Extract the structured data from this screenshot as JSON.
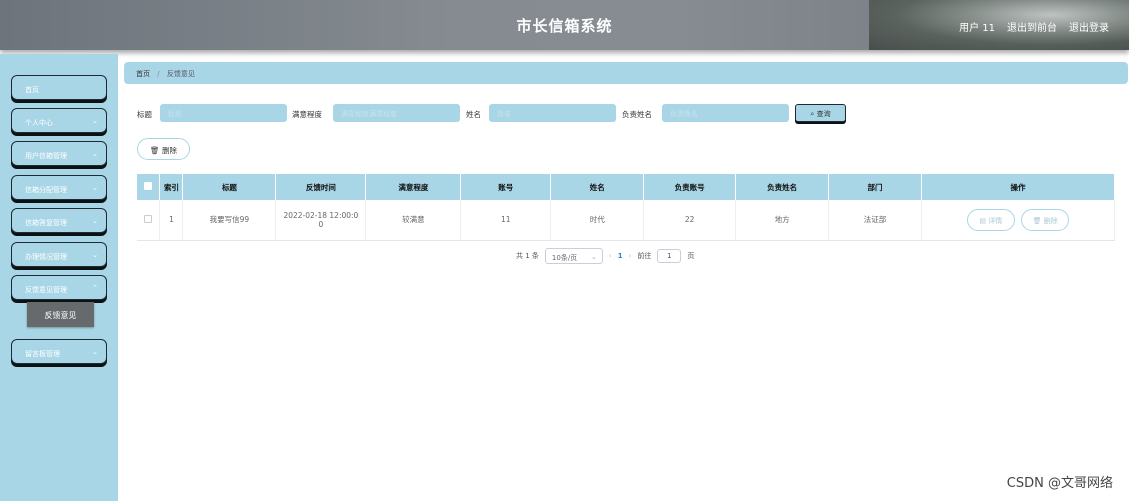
{
  "header": {
    "title": "市长信箱系统",
    "user": "用户 11",
    "back_front": "退出到前台",
    "logout": "退出登录"
  },
  "sidebar": {
    "items": [
      {
        "label": "首页"
      },
      {
        "label": "个人中心"
      },
      {
        "label": "用户信箱管理"
      },
      {
        "label": "信箱分配管理"
      },
      {
        "label": "信箱答复管理"
      },
      {
        "label": "办理情况管理"
      },
      {
        "label": "反馈意见管理"
      },
      {
        "label": "留言板管理"
      }
    ],
    "submenu": "反馈意见"
  },
  "breadcrumb": {
    "home": "首页",
    "sep": "/",
    "current": "反馈意见"
  },
  "search": {
    "title_label": "标题",
    "title_placeholder": "标题",
    "satisfaction_label": "满意程度",
    "satisfaction_placeholder": "满意程度满意程度",
    "name_label": "姓名",
    "name_placeholder": "姓名",
    "owner_label": "负责姓名",
    "owner_placeholder": "负责姓名",
    "query_button": "查询"
  },
  "actions": {
    "delete_button": "删除"
  },
  "table": {
    "headers": [
      "索引",
      "标题",
      "反馈时间",
      "满意程度",
      "账号",
      "姓名",
      "负责账号",
      "负责姓名",
      "部门",
      "操作"
    ],
    "rows": [
      {
        "index": "1",
        "title": "我要写信99",
        "time_line1": "2022-02-18 12:00:0",
        "time_line2": "0",
        "satisfaction": "较满意",
        "account": "11",
        "name": "时代",
        "owner_account": "22",
        "owner_name": "地方",
        "department": "法证部",
        "detail": "详情",
        "delete": "删除"
      }
    ]
  },
  "pager": {
    "total": "共 1 条",
    "size": "10条/页",
    "page": "1",
    "goto": "前往",
    "goto_value": "1",
    "page_unit": "页"
  },
  "watermark": "CSDN @文哥网络"
}
